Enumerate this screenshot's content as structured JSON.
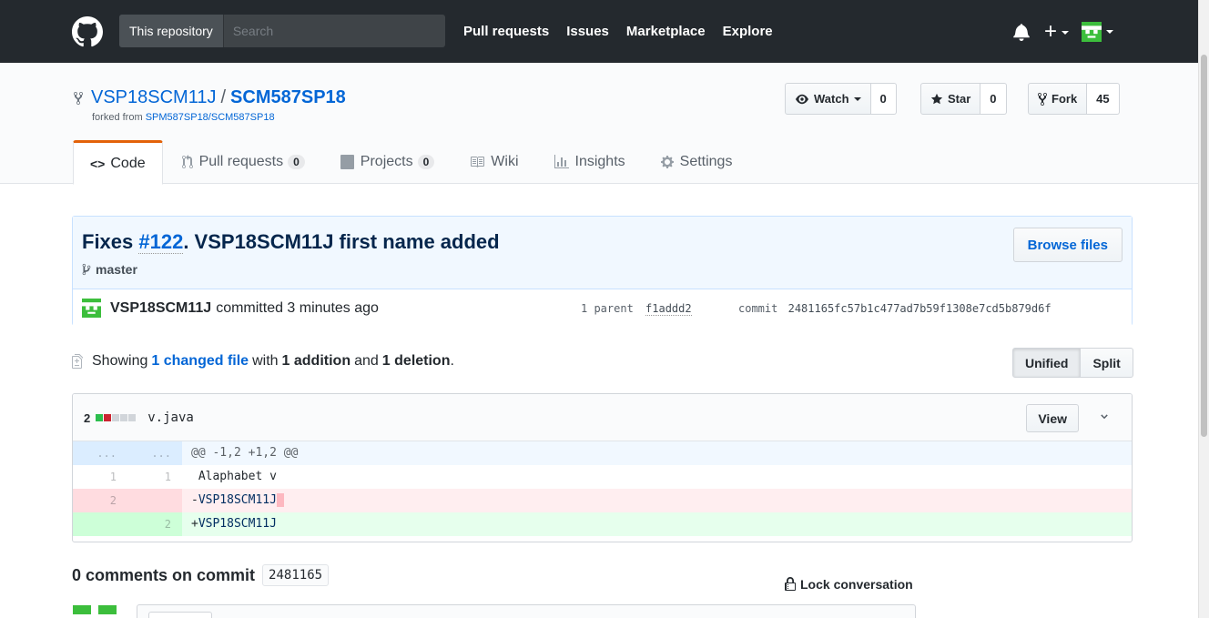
{
  "header": {
    "search_scope": "This repository",
    "search_placeholder": "Search",
    "nav": [
      "Pull requests",
      "Issues",
      "Marketplace",
      "Explore"
    ],
    "plus": "+"
  },
  "repo": {
    "owner": "VSP18SCM11J",
    "separator": "/",
    "name": "SCM587SP18",
    "forked_label": "forked from",
    "forked_from": "SPM587SP18/SCM587SP18",
    "watch_label": "Watch",
    "watch_count": "0",
    "star_label": "Star",
    "star_count": "0",
    "fork_label": "Fork",
    "fork_count": "45"
  },
  "tabs": [
    {
      "label": "Code",
      "count": null
    },
    {
      "label": "Pull requests",
      "count": "0"
    },
    {
      "label": "Projects",
      "count": "0"
    },
    {
      "label": "Wiki",
      "count": null
    },
    {
      "label": "Insights",
      "count": null
    },
    {
      "label": "Settings",
      "count": null
    }
  ],
  "tab_code_glyph": "<>",
  "commit": {
    "title_prefix": "Fixes ",
    "issue_link": "#122",
    "title_suffix": ". VSP18SCM11J first name added",
    "branch": "master",
    "browse_label": "Browse files",
    "author": "VSP18SCM11J",
    "committed_text": "committed 3 minutes ago",
    "parent_label": "1 parent",
    "parent_sha": "f1addd2",
    "commit_label": "commit",
    "commit_sha": "2481165fc57b1c477ad7b59f1308e7cd5b879d6f"
  },
  "toc": {
    "showing": "Showing",
    "changed_files": "1 changed file",
    "with": "with",
    "additions": "1 addition",
    "and": "and",
    "deletions": "1 deletion",
    "period": ".",
    "unified": "Unified",
    "split": "Split"
  },
  "file": {
    "changes": "2",
    "name": "v.java",
    "view_label": "View",
    "hunk_ln": "...",
    "hunk": "@@ -1,2 +1,2 @@",
    "lines": [
      {
        "type": "ctx",
        "old": "1",
        "new": "1",
        "sign": " ",
        "text": "Alaphabet v"
      },
      {
        "type": "del",
        "old": "2",
        "new": "",
        "sign": "-",
        "text": "VSP18SCM11J"
      },
      {
        "type": "add",
        "old": "",
        "new": "2",
        "sign": "+",
        "text": "VSP18SCM11J"
      }
    ],
    "diffstat_colors": [
      "#2cbe4e",
      "#cb2431",
      "#d1d5da",
      "#d1d5da",
      "#d1d5da"
    ]
  },
  "comments": {
    "heading": "0 comments on commit",
    "sha": "2481165",
    "lock_label": "Lock conversation"
  },
  "colors": {
    "header_bg": "#24292e",
    "link": "#0366d6",
    "tab_accent": "#e36209",
    "avatar_green": "#3cbe3c"
  },
  "icons": [
    "github-logo-icon",
    "bell-icon",
    "repo-forked-icon",
    "eye-icon",
    "star-icon",
    "code-icon",
    "git-pull-request-icon",
    "project-icon",
    "book-icon",
    "graph-icon",
    "gear-icon",
    "git-branch-icon",
    "file-diff-icon",
    "chevron-down-icon",
    "lock-icon"
  ]
}
